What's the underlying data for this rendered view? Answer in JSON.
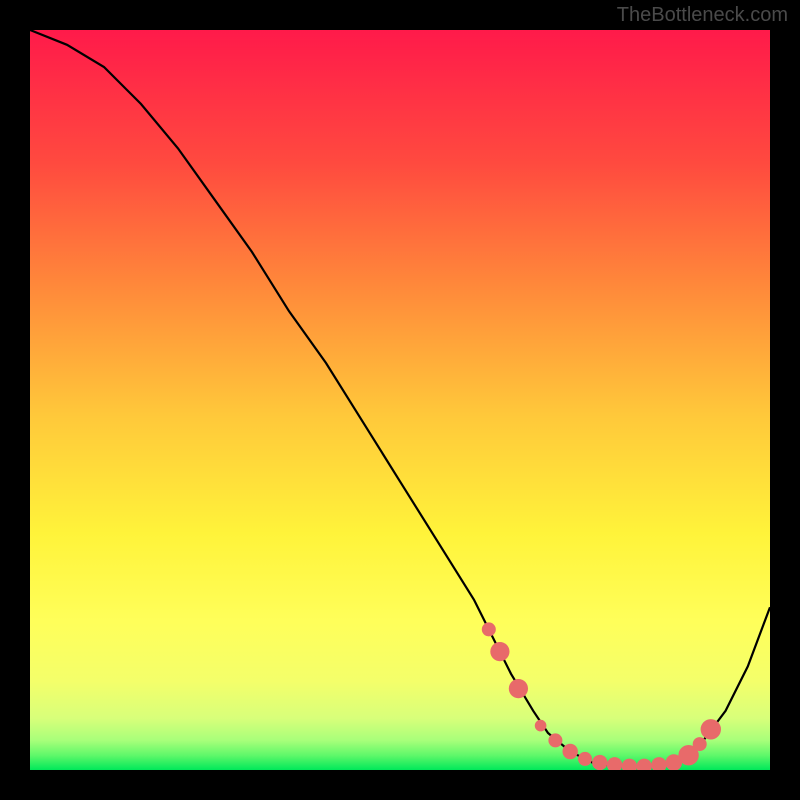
{
  "watermark": "TheBottleneck.com",
  "chart_data": {
    "type": "line",
    "title": "",
    "xlabel": "",
    "ylabel": "",
    "xlim": [
      0,
      100
    ],
    "ylim": [
      0,
      100
    ],
    "gradient_colors": {
      "top": "#ff1a4a",
      "upper_mid": "#ff7a3a",
      "mid": "#ffd93a",
      "lower_mid": "#ffff5a",
      "low": "#e8ff7a",
      "bottom": "#00e85a"
    },
    "series": [
      {
        "name": "bottleneck-curve",
        "x": [
          0,
          5,
          10,
          15,
          20,
          25,
          30,
          35,
          40,
          45,
          50,
          55,
          60,
          62,
          65,
          68,
          70,
          73,
          76,
          79,
          82,
          85,
          88,
          91,
          94,
          97,
          100
        ],
        "y": [
          100,
          98,
          95,
          90,
          84,
          77,
          70,
          62,
          55,
          47,
          39,
          31,
          23,
          19,
          13,
          8,
          5,
          2.5,
          1,
          0.5,
          0.5,
          0.7,
          1.5,
          4,
          8,
          14,
          22
        ]
      }
    ],
    "markers": {
      "name": "highlight-dots",
      "color": "#e86a6a",
      "points": [
        {
          "x": 62,
          "y": 19,
          "r": 2.2
        },
        {
          "x": 63.5,
          "y": 16,
          "r": 3.0
        },
        {
          "x": 66,
          "y": 11,
          "r": 3.0
        },
        {
          "x": 69,
          "y": 6,
          "r": 1.8
        },
        {
          "x": 71,
          "y": 4,
          "r": 2.2
        },
        {
          "x": 73,
          "y": 2.5,
          "r": 2.4
        },
        {
          "x": 75,
          "y": 1.5,
          "r": 2.2
        },
        {
          "x": 77,
          "y": 1.0,
          "r": 2.4
        },
        {
          "x": 79,
          "y": 0.7,
          "r": 2.4
        },
        {
          "x": 81,
          "y": 0.5,
          "r": 2.4
        },
        {
          "x": 83,
          "y": 0.5,
          "r": 2.4
        },
        {
          "x": 85,
          "y": 0.7,
          "r": 2.4
        },
        {
          "x": 87,
          "y": 1.0,
          "r": 2.6
        },
        {
          "x": 89,
          "y": 2.0,
          "r": 3.2
        },
        {
          "x": 90.5,
          "y": 3.5,
          "r": 2.2
        },
        {
          "x": 92,
          "y": 5.5,
          "r": 3.2
        }
      ]
    }
  }
}
